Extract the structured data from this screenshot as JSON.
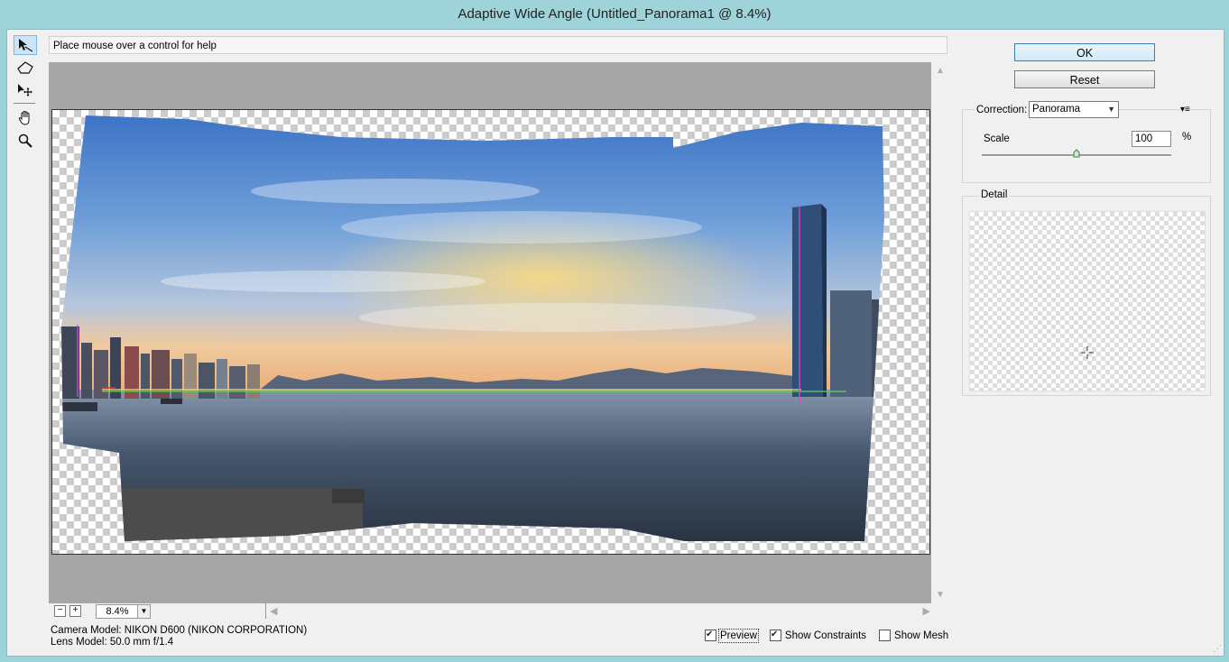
{
  "window": {
    "title": "Adaptive Wide Angle (Untitled_Panorama1 @ 8.4%)"
  },
  "help": {
    "text": "Place mouse over a control for help"
  },
  "tools": [
    {
      "name": "constraint-tool-icon"
    },
    {
      "name": "polygon-constraint-tool-icon"
    },
    {
      "name": "move-tool-icon"
    },
    {
      "name": "hand-tool-icon"
    },
    {
      "name": "zoom-tool-icon"
    }
  ],
  "zoom": {
    "minus": "−",
    "plus": "+",
    "value": "8.4%"
  },
  "info": {
    "camera": "Camera Model: NIKON D600 (NIKON CORPORATION)",
    "lens": "Lens Model: 50.0 mm f/1.4"
  },
  "checkboxes": {
    "preview": {
      "label": "Preview",
      "checked": true
    },
    "constraints": {
      "label": "Show Constraints",
      "checked": true
    },
    "mesh": {
      "label": "Show Mesh",
      "checked": false
    }
  },
  "buttons": {
    "ok": "OK",
    "reset": "Reset"
  },
  "correction": {
    "label": "Correction:",
    "value": "Panorama"
  },
  "scale": {
    "label": "Scale",
    "value": "100",
    "unit": "%",
    "level": 0.5
  },
  "detail": {
    "label": "Detail"
  },
  "colors": {
    "title_bg": "#9dd3d9",
    "accent": "#3c7fb1",
    "canvas_bg": "#a6a6a6"
  }
}
